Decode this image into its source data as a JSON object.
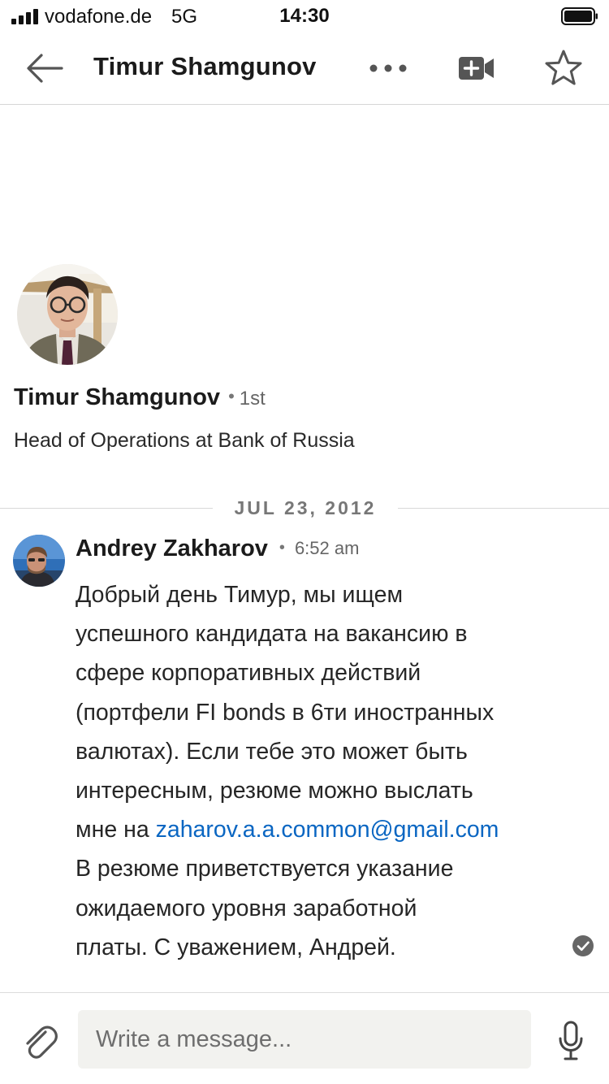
{
  "status_bar": {
    "carrier": "vodafone.de",
    "network": "5G",
    "time": "14:30"
  },
  "header": {
    "title": "Timur Shamgunov",
    "icons": {
      "back": "back-arrow-icon",
      "more": "more-horizontal-icon",
      "video": "video-call-icon",
      "star": "star-icon"
    }
  },
  "profile": {
    "name": "Timur Shamgunov",
    "degree_separator": "•",
    "degree": "1st",
    "headline": "Head of Operations at Bank of Russia"
  },
  "conversation": {
    "date": "JUL 23, 2012",
    "messages": [
      {
        "sender": "Andrey Zakharov",
        "separator": "•",
        "time": "6:52 am",
        "lines": [
          "Добрый день Тимур, мы ищем",
          "успешного кандидата на вакансию в",
          "сфере корпоративных действий",
          "(портфели FI bonds в 6ти иностранных",
          "валютах). Если тебе это может быть",
          "интересным, резюме можно выслать",
          "мне на ",
          "В резюме приветствуется указание",
          "ожидаемого уровня заработной",
          "платы. С уважением, Андрей."
        ],
        "link": "zaharov.a.a.common@gmail.com",
        "status_icon": "read-check-icon"
      }
    ]
  },
  "composer": {
    "placeholder": "Write a message...",
    "value": "",
    "icons": {
      "attach": "paperclip-icon",
      "mic": "microphone-icon"
    }
  },
  "colors": {
    "link": "#0a66c2",
    "divider": "#d9d9d9",
    "input_background": "#f2f2ef",
    "text_primary": "#1b1b1b",
    "text_secondary": "#666666"
  }
}
